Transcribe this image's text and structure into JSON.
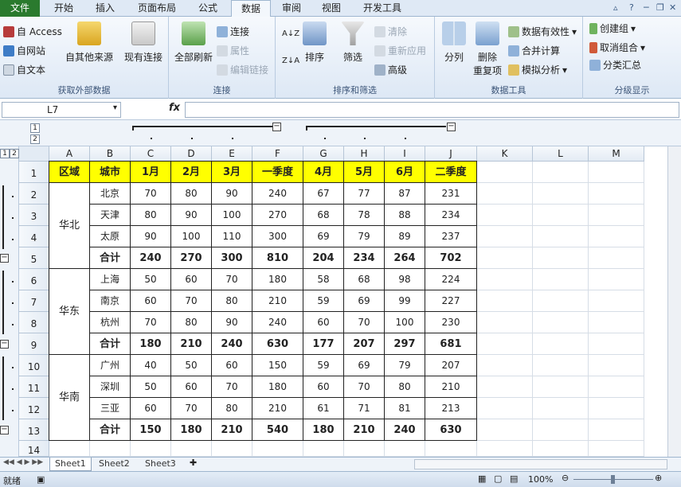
{
  "tabs": {
    "file": "文件",
    "items": [
      "开始",
      "插入",
      "页面布局",
      "公式",
      "数据",
      "审阅",
      "视图",
      "开发工具"
    ],
    "active": "数据"
  },
  "ribbon": {
    "external": {
      "access": "自 Access",
      "web": "自网站",
      "text": "自文本",
      "other": "自其他来源",
      "existing": "现有连接",
      "label": "获取外部数据"
    },
    "connections": {
      "refresh_all": "全部刷新",
      "connections": "连接",
      "properties": "属性",
      "edit_links": "编辑链接",
      "label": "连接"
    },
    "sort_filter": {
      "sort": "排序",
      "filter": "筛选",
      "clear": "清除",
      "reapply": "重新应用",
      "advanced": "高级",
      "label": "排序和筛选"
    },
    "data_tools": {
      "split": "分列",
      "remove_dup": "删除",
      "remove_dup2": "重复项",
      "validation": "数据有效性",
      "consolidate": "合并计算",
      "whatif": "模拟分析",
      "label": "数据工具"
    },
    "outline": {
      "group": "创建组",
      "ungroup": "取消组合",
      "subtotal": "分类汇总",
      "label": "分级显示"
    }
  },
  "formula_bar": {
    "name_box": "L7",
    "fx": "fx",
    "value": ""
  },
  "outline": {
    "levels": [
      "1",
      "2"
    ],
    "minus": "−"
  },
  "columns": [
    "A",
    "B",
    "C",
    "D",
    "E",
    "F",
    "G",
    "H",
    "I",
    "J",
    "K",
    "L",
    "M"
  ],
  "rows": [
    "1",
    "2",
    "3",
    "4",
    "5",
    "6",
    "7",
    "8",
    "9",
    "10",
    "11",
    "12",
    "13",
    "14"
  ],
  "table": {
    "headers": [
      "区域",
      "城市",
      "1月",
      "2月",
      "3月",
      "一季度",
      "4月",
      "5月",
      "6月",
      "二季度"
    ],
    "regions": [
      {
        "name": "华北",
        "rows": [
          [
            "北京",
            "70",
            "80",
            "90",
            "240",
            "67",
            "77",
            "87",
            "231"
          ],
          [
            "天津",
            "80",
            "90",
            "100",
            "270",
            "68",
            "78",
            "88",
            "234"
          ],
          [
            "太原",
            "90",
            "100",
            "110",
            "300",
            "69",
            "79",
            "89",
            "237"
          ]
        ],
        "total": [
          "合计",
          "240",
          "270",
          "300",
          "810",
          "204",
          "234",
          "264",
          "702"
        ]
      },
      {
        "name": "华东",
        "rows": [
          [
            "上海",
            "50",
            "60",
            "70",
            "180",
            "58",
            "68",
            "98",
            "224"
          ],
          [
            "南京",
            "60",
            "70",
            "80",
            "210",
            "59",
            "69",
            "99",
            "227"
          ],
          [
            "杭州",
            "70",
            "80",
            "90",
            "240",
            "60",
            "70",
            "100",
            "230"
          ]
        ],
        "total": [
          "合计",
          "180",
          "210",
          "240",
          "630",
          "177",
          "207",
          "297",
          "681"
        ]
      },
      {
        "name": "华南",
        "rows": [
          [
            "广州",
            "40",
            "50",
            "60",
            "150",
            "59",
            "69",
            "79",
            "207"
          ],
          [
            "深圳",
            "50",
            "60",
            "70",
            "180",
            "60",
            "70",
            "80",
            "210"
          ],
          [
            "三亚",
            "60",
            "70",
            "80",
            "210",
            "61",
            "71",
            "81",
            "213"
          ]
        ],
        "total": [
          "合计",
          "150",
          "180",
          "210",
          "540",
          "180",
          "210",
          "240",
          "630"
        ]
      }
    ]
  },
  "sheets": [
    "Sheet1",
    "Sheet2",
    "Sheet3"
  ],
  "status": {
    "ready": "就绪",
    "zoom": "100%"
  }
}
